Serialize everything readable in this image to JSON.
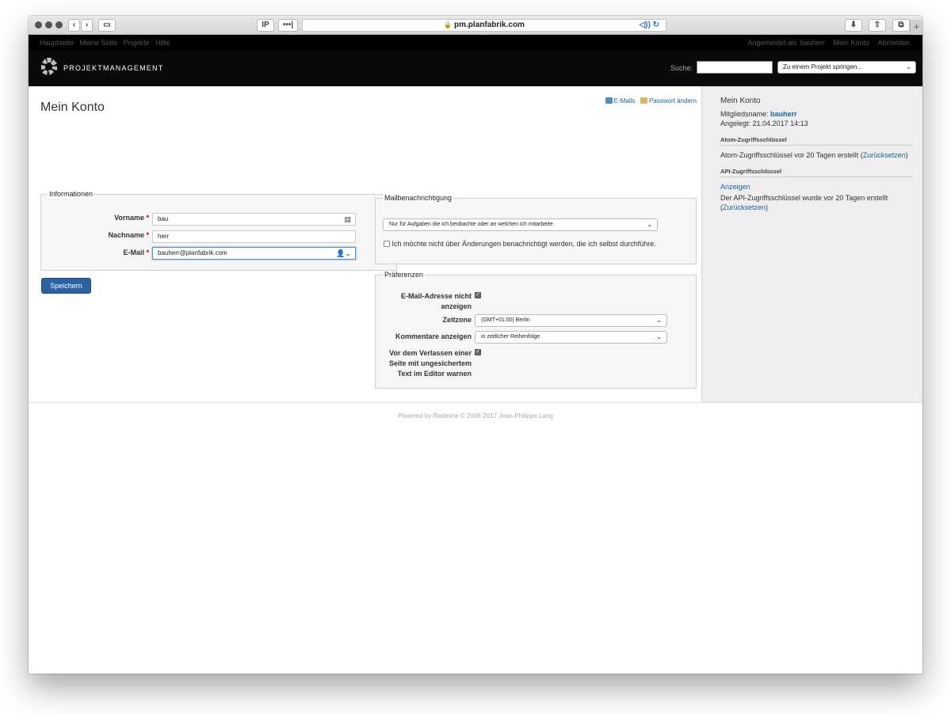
{
  "browser": {
    "url": "pm.planfabrik.com",
    "ip_label": "IP",
    "dots_label": "•••|"
  },
  "top_menu": {
    "left": [
      "Hauptseite",
      "Meine Seite",
      "Projekte",
      "Hilfe"
    ],
    "logged_in_prefix": "Angemeldet als",
    "logged_in_user": "bauherr",
    "my_account": "Mein Konto",
    "logout": "Abmelden"
  },
  "header": {
    "title": "PROJEKTMANAGEMENT",
    "search_label": "Suche:",
    "search_value": "",
    "jump_label": "Zu einem Projekt springen..."
  },
  "page": {
    "title": "Mein Konto",
    "contextual": {
      "emails": "E-Mails",
      "password": "Passwort ändern"
    }
  },
  "info": {
    "legend": "Informationen",
    "firstname_label": "Vorname",
    "firstname_value": "bau",
    "lastname_label": "Nachname",
    "lastname_value": "herr",
    "email_label": "E-Mail",
    "email_value": "bauherr@planfabrik.com",
    "required_mark": "*"
  },
  "save_button": "Speichern",
  "mail": {
    "legend": "Mailbenachrichtigung",
    "select_value": "Nur für Aufgaben die ich beobachte oder an welchen ich mitarbeite",
    "self_notify": "Ich möchte nicht über Änderungen benachrichtigt werden, die ich selbst durchführe."
  },
  "prefs": {
    "legend": "Präferenzen",
    "hide_mail_line1": "E-Mail-Adresse nicht",
    "hide_mail_line2": "anzeigen",
    "timezone_label": "Zeitzone",
    "timezone_value": "(GMT+01:00) Berlin",
    "comments_label": "Kommentare anzeigen",
    "comments_value": "in zeitlicher Reihenfolge",
    "warn_line1": "Vor dem Verlassen einer",
    "warn_line2": "Seite mit ungesichertem",
    "warn_line3": "Text im Editor warnen"
  },
  "sidebar": {
    "title": "Mein Konto",
    "login_label": "Mitgliedsname:",
    "login_value": "bauherr",
    "created": "Angelegt: 21.04.2017 14:13",
    "atom_heading": "Atom-Zugriffsschlüssel",
    "atom_text": "Atom-Zugriffsschlüssel vor 20 Tagen erstellt",
    "reset": "Zurücksetzen",
    "api_heading": "API-Zugriffsschlüssel",
    "api_show": "Anzeigen",
    "api_text": "Der API-Zugriffsschlüssel wurde vor 20 Tagen erstellt"
  },
  "footer": "Powered by Redmine © 2006-2017 Jean-Philippe Lang"
}
